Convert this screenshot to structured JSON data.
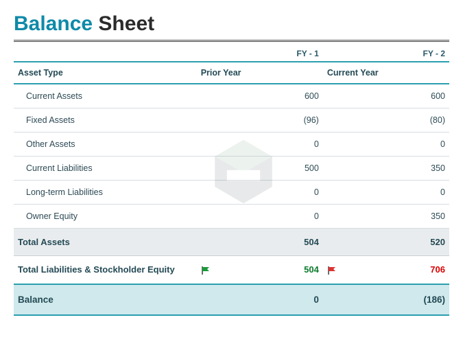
{
  "title": {
    "accent": "Balance",
    "rest": "Sheet"
  },
  "columns": {
    "fy1": "FY - 1",
    "fy2": "FY - 2",
    "asset_type": "Asset Type",
    "prior": "Prior Year",
    "current": "Current Year"
  },
  "rows": [
    {
      "label": "Current Assets",
      "fy1": "600",
      "fy1_neg": false,
      "fy2": "600",
      "fy2_neg": false
    },
    {
      "label": "Fixed Assets",
      "fy1": "(96)",
      "fy1_neg": true,
      "fy2": "(80)",
      "fy2_neg": true
    },
    {
      "label": "Other Assets",
      "fy1": "0",
      "fy1_neg": false,
      "fy2": "0",
      "fy2_neg": false
    },
    {
      "label": "Current Liabilities",
      "fy1": "500",
      "fy1_neg": false,
      "fy2": "350",
      "fy2_neg": false
    },
    {
      "label": "Long-term Liabilities",
      "fy1": "0",
      "fy1_neg": false,
      "fy2": "0",
      "fy2_neg": false
    },
    {
      "label": "Owner Equity",
      "fy1": "0",
      "fy1_neg": false,
      "fy2": "350",
      "fy2_neg": false
    }
  ],
  "totals": {
    "assets_label": "Total Assets",
    "assets_fy1": "504",
    "assets_fy2": "520",
    "liab_label": "Total Liabilities & Stockholder Equity",
    "liab_fy1": "504",
    "liab_fy1_flag": "green",
    "liab_fy2": "706",
    "liab_fy2_flag": "red",
    "balance_label": "Balance",
    "balance_fy1": "0",
    "balance_fy1_neg": false,
    "balance_fy2": "(186)",
    "balance_fy2_neg": true
  },
  "chart_data": {
    "type": "table",
    "title": "Balance Sheet",
    "columns": [
      "Asset Type",
      "FY - 1 (Prior Year)",
      "FY - 2 (Current Year)"
    ],
    "rows": [
      [
        "Current Assets",
        600,
        600
      ],
      [
        "Fixed Assets",
        -96,
        -80
      ],
      [
        "Other Assets",
        0,
        0
      ],
      [
        "Current Liabilities",
        500,
        350
      ],
      [
        "Long-term Liabilities",
        0,
        0
      ],
      [
        "Owner Equity",
        0,
        350
      ],
      [
        "Total Assets",
        504,
        520
      ],
      [
        "Total Liabilities & Stockholder Equity",
        504,
        706
      ],
      [
        "Balance",
        0,
        -186
      ]
    ]
  }
}
